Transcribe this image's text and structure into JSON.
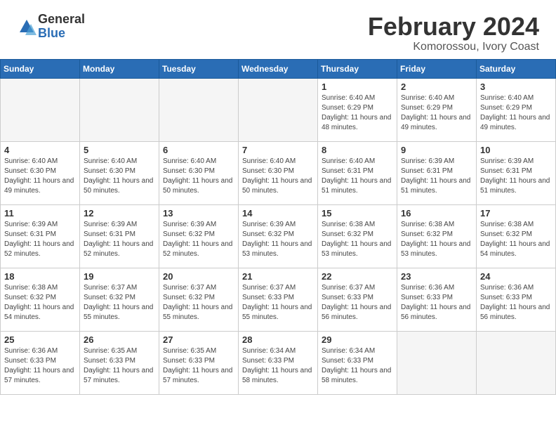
{
  "header": {
    "logo_general": "General",
    "logo_blue": "Blue",
    "main_title": "February 2024",
    "subtitle": "Komorossou, Ivory Coast"
  },
  "calendar": {
    "days_of_week": [
      "Sunday",
      "Monday",
      "Tuesday",
      "Wednesday",
      "Thursday",
      "Friday",
      "Saturday"
    ],
    "weeks": [
      [
        {
          "day": "",
          "info": ""
        },
        {
          "day": "",
          "info": ""
        },
        {
          "day": "",
          "info": ""
        },
        {
          "day": "",
          "info": ""
        },
        {
          "day": "1",
          "info": "Sunrise: 6:40 AM\nSunset: 6:29 PM\nDaylight: 11 hours and 48 minutes."
        },
        {
          "day": "2",
          "info": "Sunrise: 6:40 AM\nSunset: 6:29 PM\nDaylight: 11 hours and 49 minutes."
        },
        {
          "day": "3",
          "info": "Sunrise: 6:40 AM\nSunset: 6:29 PM\nDaylight: 11 hours and 49 minutes."
        }
      ],
      [
        {
          "day": "4",
          "info": "Sunrise: 6:40 AM\nSunset: 6:30 PM\nDaylight: 11 hours and 49 minutes."
        },
        {
          "day": "5",
          "info": "Sunrise: 6:40 AM\nSunset: 6:30 PM\nDaylight: 11 hours and 50 minutes."
        },
        {
          "day": "6",
          "info": "Sunrise: 6:40 AM\nSunset: 6:30 PM\nDaylight: 11 hours and 50 minutes."
        },
        {
          "day": "7",
          "info": "Sunrise: 6:40 AM\nSunset: 6:30 PM\nDaylight: 11 hours and 50 minutes."
        },
        {
          "day": "8",
          "info": "Sunrise: 6:40 AM\nSunset: 6:31 PM\nDaylight: 11 hours and 51 minutes."
        },
        {
          "day": "9",
          "info": "Sunrise: 6:39 AM\nSunset: 6:31 PM\nDaylight: 11 hours and 51 minutes."
        },
        {
          "day": "10",
          "info": "Sunrise: 6:39 AM\nSunset: 6:31 PM\nDaylight: 11 hours and 51 minutes."
        }
      ],
      [
        {
          "day": "11",
          "info": "Sunrise: 6:39 AM\nSunset: 6:31 PM\nDaylight: 11 hours and 52 minutes."
        },
        {
          "day": "12",
          "info": "Sunrise: 6:39 AM\nSunset: 6:31 PM\nDaylight: 11 hours and 52 minutes."
        },
        {
          "day": "13",
          "info": "Sunrise: 6:39 AM\nSunset: 6:32 PM\nDaylight: 11 hours and 52 minutes."
        },
        {
          "day": "14",
          "info": "Sunrise: 6:39 AM\nSunset: 6:32 PM\nDaylight: 11 hours and 53 minutes."
        },
        {
          "day": "15",
          "info": "Sunrise: 6:38 AM\nSunset: 6:32 PM\nDaylight: 11 hours and 53 minutes."
        },
        {
          "day": "16",
          "info": "Sunrise: 6:38 AM\nSunset: 6:32 PM\nDaylight: 11 hours and 53 minutes."
        },
        {
          "day": "17",
          "info": "Sunrise: 6:38 AM\nSunset: 6:32 PM\nDaylight: 11 hours and 54 minutes."
        }
      ],
      [
        {
          "day": "18",
          "info": "Sunrise: 6:38 AM\nSunset: 6:32 PM\nDaylight: 11 hours and 54 minutes."
        },
        {
          "day": "19",
          "info": "Sunrise: 6:37 AM\nSunset: 6:32 PM\nDaylight: 11 hours and 55 minutes."
        },
        {
          "day": "20",
          "info": "Sunrise: 6:37 AM\nSunset: 6:32 PM\nDaylight: 11 hours and 55 minutes."
        },
        {
          "day": "21",
          "info": "Sunrise: 6:37 AM\nSunset: 6:33 PM\nDaylight: 11 hours and 55 minutes."
        },
        {
          "day": "22",
          "info": "Sunrise: 6:37 AM\nSunset: 6:33 PM\nDaylight: 11 hours and 56 minutes."
        },
        {
          "day": "23",
          "info": "Sunrise: 6:36 AM\nSunset: 6:33 PM\nDaylight: 11 hours and 56 minutes."
        },
        {
          "day": "24",
          "info": "Sunrise: 6:36 AM\nSunset: 6:33 PM\nDaylight: 11 hours and 56 minutes."
        }
      ],
      [
        {
          "day": "25",
          "info": "Sunrise: 6:36 AM\nSunset: 6:33 PM\nDaylight: 11 hours and 57 minutes."
        },
        {
          "day": "26",
          "info": "Sunrise: 6:35 AM\nSunset: 6:33 PM\nDaylight: 11 hours and 57 minutes."
        },
        {
          "day": "27",
          "info": "Sunrise: 6:35 AM\nSunset: 6:33 PM\nDaylight: 11 hours and 57 minutes."
        },
        {
          "day": "28",
          "info": "Sunrise: 6:34 AM\nSunset: 6:33 PM\nDaylight: 11 hours and 58 minutes."
        },
        {
          "day": "29",
          "info": "Sunrise: 6:34 AM\nSunset: 6:33 PM\nDaylight: 11 hours and 58 minutes."
        },
        {
          "day": "",
          "info": ""
        },
        {
          "day": "",
          "info": ""
        }
      ]
    ]
  }
}
